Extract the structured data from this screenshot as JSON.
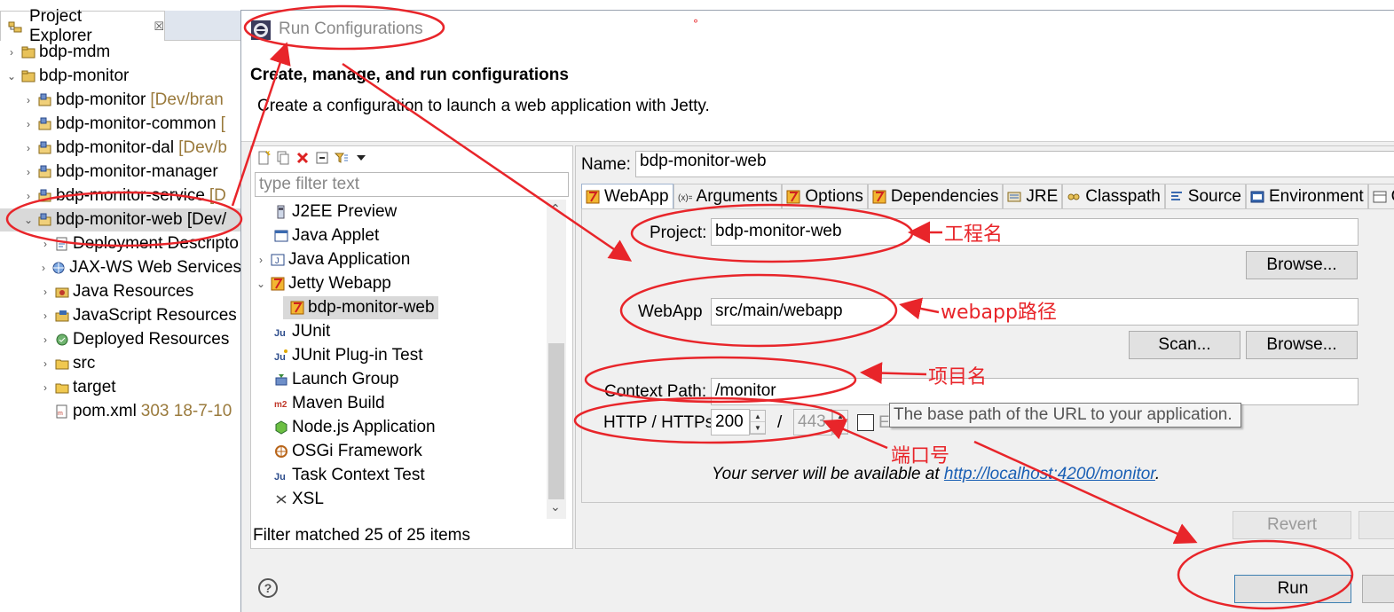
{
  "explorer": {
    "title": "Project Explorer",
    "close_glyph": "☒",
    "rows": [
      {
        "label": "bdp-mdm",
        "deco": "",
        "icon": "project-icon"
      },
      {
        "label": "bdp-monitor",
        "deco": "",
        "icon": "project-icon"
      },
      {
        "label": "bdp-monitor",
        "deco": "[Dev/bran",
        "icon": "module-icon"
      },
      {
        "label": "bdp-monitor-common",
        "deco": "[",
        "icon": "module-icon"
      },
      {
        "label": "bdp-monitor-dal",
        "deco": "[Dev/b",
        "icon": "module-icon"
      },
      {
        "label": "bdp-monitor-manager",
        "deco": "",
        "icon": "module-icon"
      },
      {
        "label": "bdp-monitor-service",
        "deco": "[D",
        "icon": "module-icon"
      },
      {
        "label": "bdp-monitor-web [Dev/",
        "deco": "",
        "icon": "module-icon"
      },
      {
        "label": "Deployment Descripto",
        "deco": "",
        "icon": "descriptor-icon"
      },
      {
        "label": "JAX-WS Web Services",
        "deco": "",
        "icon": "webservice-icon"
      },
      {
        "label": "Java Resources",
        "deco": "",
        "icon": "java-resources-icon"
      },
      {
        "label": "JavaScript Resources",
        "deco": "",
        "icon": "js-resources-icon"
      },
      {
        "label": "Deployed Resources",
        "deco": "",
        "icon": "deployed-icon"
      },
      {
        "label": "src",
        "deco": "",
        "icon": "folder-icon"
      },
      {
        "label": "target",
        "deco": "",
        "icon": "folder-icon"
      },
      {
        "label": "pom.xml",
        "deco": "303  18-7-10",
        "icon": "xml-file-icon"
      }
    ]
  },
  "dialog": {
    "title": "Run Configurations",
    "header_title": "Create, manage, and run configurations",
    "header_message": "Create a configuration to launch a web application with Jetty.",
    "filter_placeholder": "type filter text",
    "config_types": [
      {
        "label": "J2EE Preview",
        "icon": "j2ee-icon"
      },
      {
        "label": "Java Applet",
        "icon": "applet-icon"
      },
      {
        "label": "Java Application",
        "icon": "java-app-icon"
      },
      {
        "label": "Jetty Webapp",
        "icon": "jetty-icon"
      },
      {
        "label": "bdp-monitor-web",
        "icon": "jetty-icon"
      },
      {
        "label": "JUnit",
        "icon": "junit-icon"
      },
      {
        "label": "JUnit Plug-in Test",
        "icon": "junit-plugin-icon"
      },
      {
        "label": "Launch Group",
        "icon": "launch-group-icon"
      },
      {
        "label": "Maven Build",
        "icon": "maven-icon"
      },
      {
        "label": "Node.js Application",
        "icon": "nodejs-icon"
      },
      {
        "label": "OSGi Framework",
        "icon": "osgi-icon"
      },
      {
        "label": "Task Context Test",
        "icon": "task-icon"
      },
      {
        "label": "XSL",
        "icon": "xsl-icon"
      }
    ],
    "filter_status": "Filter matched 25 of 25 items",
    "name_label": "Name:",
    "name_value": "bdp-monitor-web",
    "tabs": [
      "WebApp",
      "Arguments",
      "Options",
      "Dependencies",
      "JRE",
      "Classpath",
      "Source",
      "Environment",
      "C"
    ],
    "project_label": "Project:",
    "project_value": "bdp-monitor-web",
    "webapp_label": "WebApp",
    "webapp_value": "src/main/webapp",
    "context_label": "Context Path:",
    "context_value": "/monitor",
    "http_label": "HTTP / HTTPs",
    "http_port": "200",
    "https_sep": "/",
    "https_port": "443",
    "enable_https": "Enable HTTPS",
    "tooltip": "The base path of the URL to your application.",
    "server_text": "Your server will be available at ",
    "server_url": "http://localhost:4200/monitor",
    "server_end": ".",
    "browse": "Browse...",
    "scan": "Scan...",
    "revert": "Revert",
    "run": "Run",
    "help_glyph": "?"
  },
  "annotations": {
    "project_name": "工程名",
    "webapp_path": "webapp路径",
    "context_name": "项目名",
    "port": "端口号",
    "dot": "°"
  },
  "colors": {
    "annotation_red": "#e8252a",
    "selection_gray": "#d9d9d9",
    "link_blue": "#1a5fb4"
  }
}
